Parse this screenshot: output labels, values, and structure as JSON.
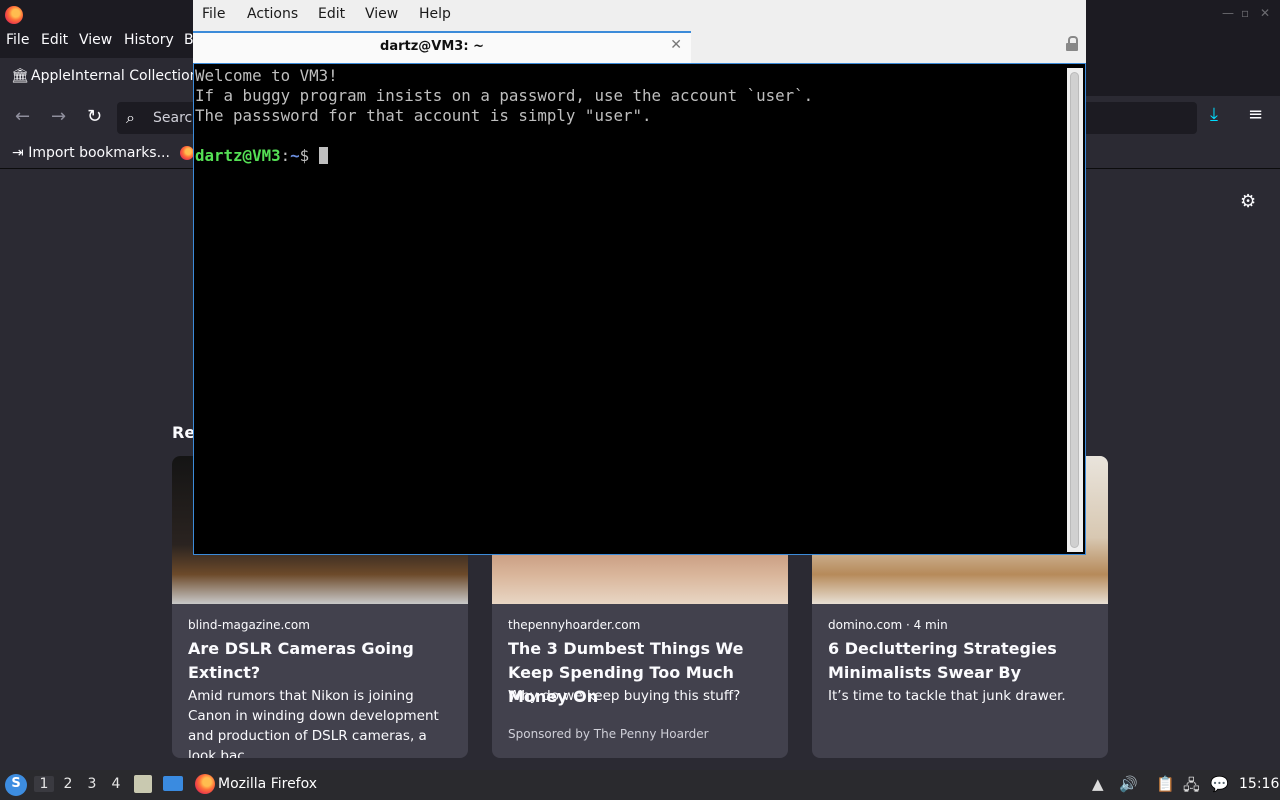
{
  "firefox": {
    "menu": [
      "File",
      "Edit",
      "View",
      "History",
      "B"
    ],
    "tab_label": "AppleInternal Collection",
    "search_placeholder": "Search",
    "bookmarks": {
      "import_label": "Import bookmarks..."
    },
    "section_heading": "Re",
    "cards": [
      {
        "source": "blind-magazine.com",
        "title": "Are DSLR Cameras Going Extinct?",
        "excerpt": "Amid rumors that Nikon is joining Canon in winding down development and production of DSLR cameras, a look bac…",
        "sponsor": ""
      },
      {
        "source": "thepennyhoarder.com",
        "title": "The 3 Dumbest Things We Keep Spending Too Much Money On",
        "excerpt": "Why do we keep buying this stuff?",
        "sponsor": "Sponsored by The Penny Hoarder"
      },
      {
        "source": "domino.com · 4 min",
        "title": "6 Decluttering Strategies Minimalists Swear By",
        "excerpt": "It’s time to tackle that junk drawer.",
        "sponsor": ""
      }
    ]
  },
  "terminal": {
    "menu": [
      "File",
      "Actions",
      "Edit",
      "View",
      "Help"
    ],
    "tab_title": "dartz@VM3: ~",
    "lines": [
      "Welcome to VM3!",
      "If a buggy program insists on a password, use the account `user`.",
      "The passsword for that account is simply \"user\"."
    ],
    "prompt_user": "dartz@VM3",
    "prompt_sep": ":",
    "prompt_path": "~",
    "prompt_symbol": "$ "
  },
  "taskbar": {
    "workspaces": [
      "1",
      "2",
      "3",
      "4"
    ],
    "task_label": "Mozilla Firefox",
    "clock": "15:16"
  },
  "icons": {
    "firefox": "firefox-icon",
    "lock": "lock-icon",
    "download": "download-icon"
  },
  "colors": {
    "accent_blue": "#3c8bd9",
    "prompt_green": "#55e055",
    "prompt_blue": "#6c8fe0",
    "firefox_bg": "#2b2a33"
  }
}
